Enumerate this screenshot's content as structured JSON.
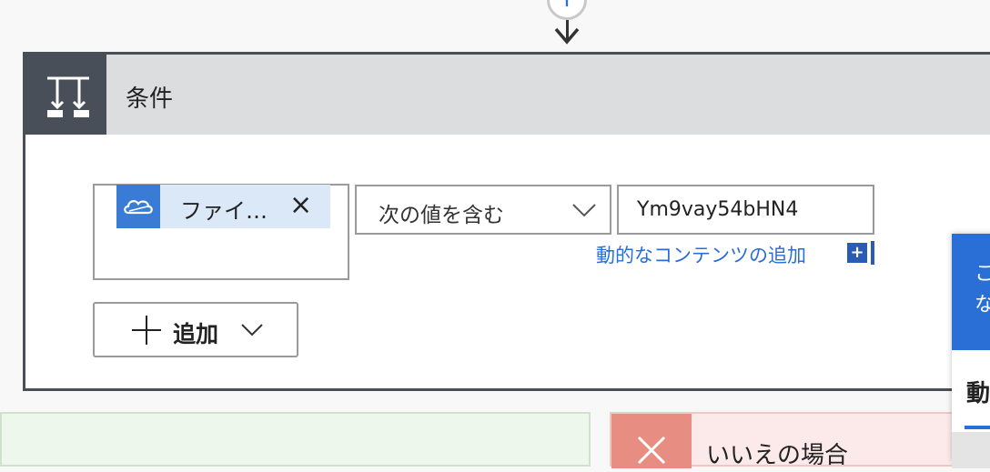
{
  "connector": {
    "plus_symbol": "+"
  },
  "condition": {
    "title": "条件"
  },
  "left_operand": {
    "token_label": "ファイ…",
    "token_remove_symbol": "×",
    "token_icon": "onedrive-cloud-icon"
  },
  "operator": {
    "selected": "次の値を含む"
  },
  "right_operand": {
    "value": "Ym9vay54bHN4"
  },
  "dynamic_content": {
    "link_text": "動的なコンテンツの追加",
    "plus_symbol": "+"
  },
  "add_button": {
    "label": "追加"
  },
  "branches": {
    "no_label": "いいえの場合"
  },
  "flyout": {
    "blue_text_line1": "こ",
    "blue_text_line2": "な",
    "tab_label": "動"
  },
  "colors": {
    "accent": "#2a6fd6",
    "card_border": "#4a4e56",
    "header_bg": "#dcdddf",
    "no_branch": "#e88d82",
    "yes_branch_bg": "#eef7ec"
  }
}
